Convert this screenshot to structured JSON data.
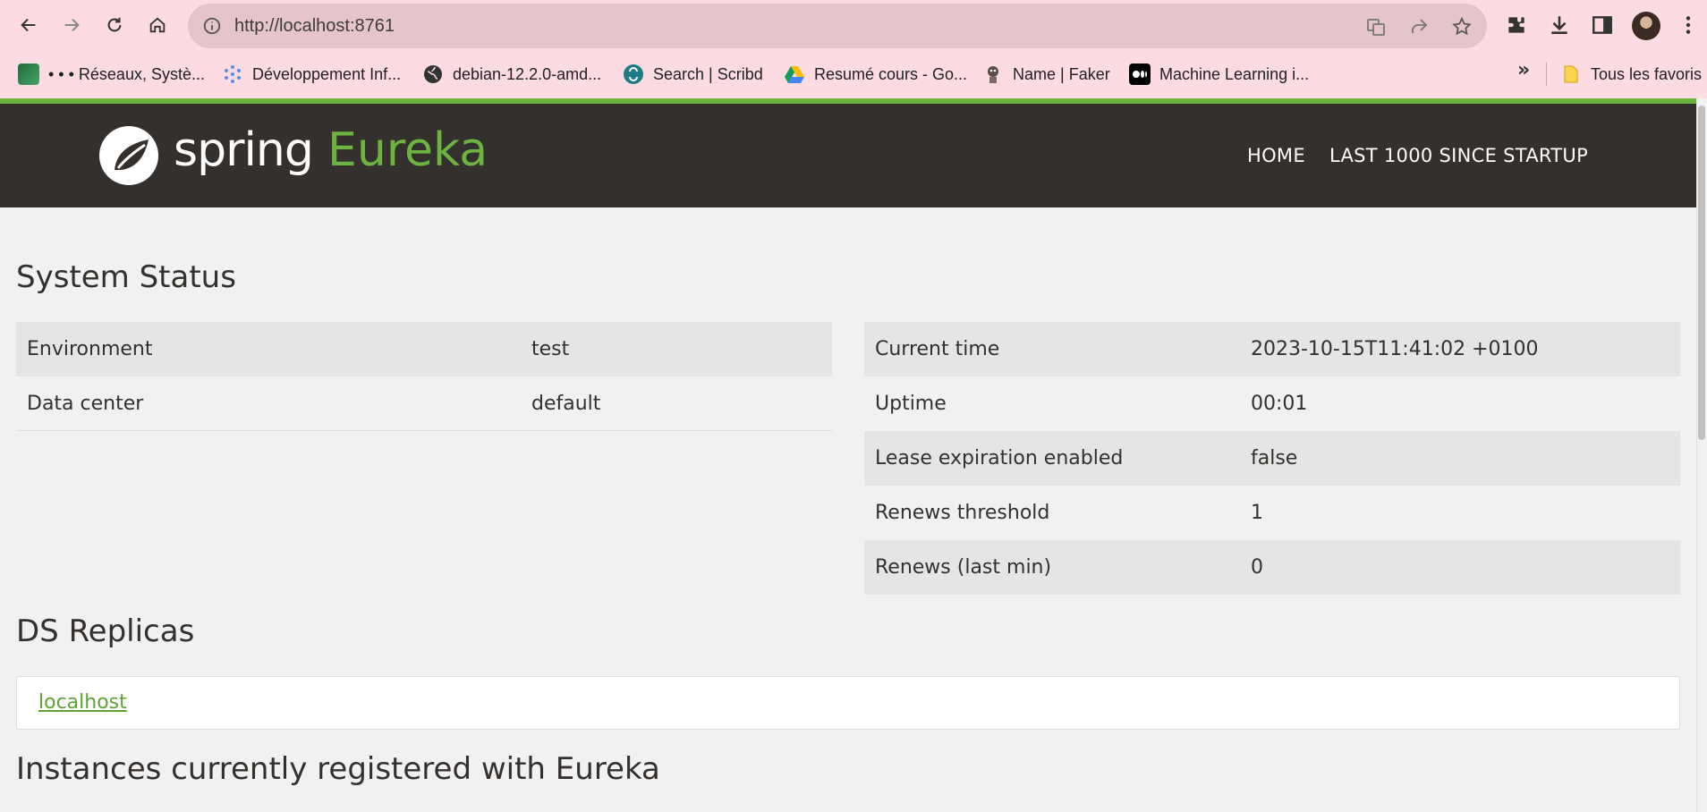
{
  "browser": {
    "url": "http://localhost:8761",
    "bookmarks": [
      {
        "label": "• • • Réseaux, Systè..."
      },
      {
        "label": "Développement Inf..."
      },
      {
        "label": "debian-12.2.0-amd..."
      },
      {
        "label": "Search | Scribd"
      },
      {
        "label": "Resumé cours - Go..."
      },
      {
        "label": "Name | Faker"
      },
      {
        "label": "Machine Learning i..."
      }
    ],
    "more_bookmarks": "»",
    "all_bookmarks": "Tous les favoris"
  },
  "header": {
    "logo_spring": "spring",
    "logo_eureka": "Eureka",
    "nav": {
      "home": "HOME",
      "last1000": "LAST 1000 SINCE STARTUP"
    }
  },
  "system_status": {
    "title": "System Status",
    "left": [
      {
        "key": "Environment",
        "value": "test"
      },
      {
        "key": "Data center",
        "value": "default"
      }
    ],
    "right": [
      {
        "key": "Current time",
        "value": "2023-10-15T11:41:02 +0100"
      },
      {
        "key": "Uptime",
        "value": "00:01"
      },
      {
        "key": "Lease expiration enabled",
        "value": "false"
      },
      {
        "key": "Renews threshold",
        "value": "1"
      },
      {
        "key": "Renews (last min)",
        "value": "0"
      }
    ]
  },
  "ds_replicas": {
    "title": "DS Replicas",
    "link": "localhost"
  },
  "instances": {
    "title": "Instances currently registered with Eureka"
  },
  "colors": {
    "brand_green": "#6db33f",
    "navbar": "#34302d",
    "chrome_pink": "#fcdbe3"
  }
}
